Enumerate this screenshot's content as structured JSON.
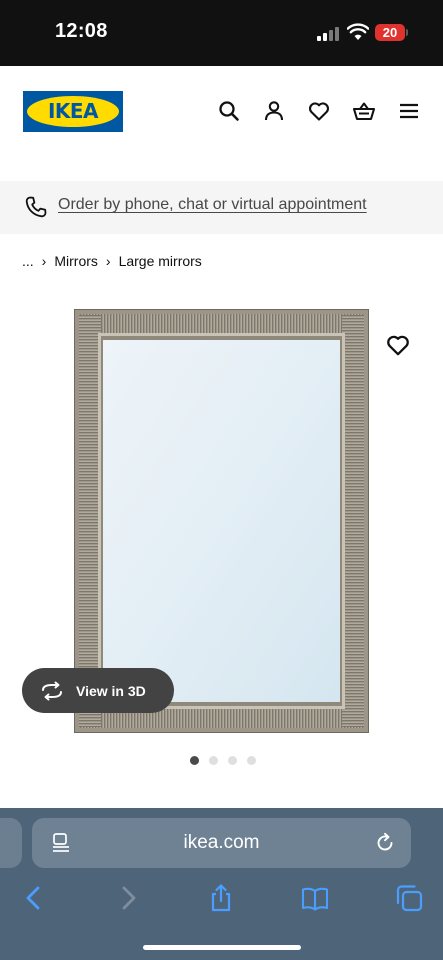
{
  "status_bar": {
    "time": "12:08",
    "battery": "20",
    "battery_color": "#e0322e"
  },
  "header": {
    "logo_text": "IKEA",
    "brand_blue": "#0058a3",
    "brand_yellow": "#ffdb00",
    "icons": [
      "search-icon",
      "account-icon",
      "wishlist-heart-icon",
      "basket-icon",
      "menu-icon"
    ]
  },
  "contact_banner": {
    "icon": "phone-icon",
    "link_text": "Order by phone, chat or virtual appointment"
  },
  "breadcrumb": {
    "items": [
      "...",
      "Mirrors",
      "Large mirrors"
    ]
  },
  "product": {
    "image": "framed-silver-mirror",
    "wishlist_icon": "heart-outline-icon",
    "view_3d_label": "View in 3D",
    "carousel": {
      "count": 4,
      "active_index": 0
    }
  },
  "browser": {
    "url": "ikea.com",
    "toolbar_icons": [
      "back-icon",
      "forward-icon",
      "share-icon",
      "bookmarks-icon",
      "tabs-icon"
    ]
  }
}
